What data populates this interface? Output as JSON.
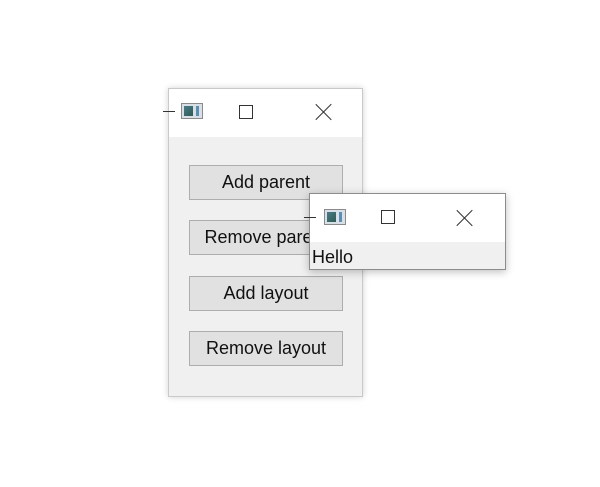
{
  "main_window": {
    "buttons": [
      {
        "label": "Add parent"
      },
      {
        "label": "Remove parent"
      },
      {
        "label": "Add layout"
      },
      {
        "label": "Remove layout"
      }
    ]
  },
  "child_window": {
    "content_text": "Hello"
  },
  "icons": {
    "app": "app-window-icon",
    "minimize": "minimize-icon",
    "maximize": "maximize-icon",
    "close": "close-icon"
  },
  "colors": {
    "window_bg": "#f0f0f0",
    "titlebar_bg": "#ffffff",
    "button_bg": "#e1e1e1",
    "button_border": "#adadad"
  }
}
